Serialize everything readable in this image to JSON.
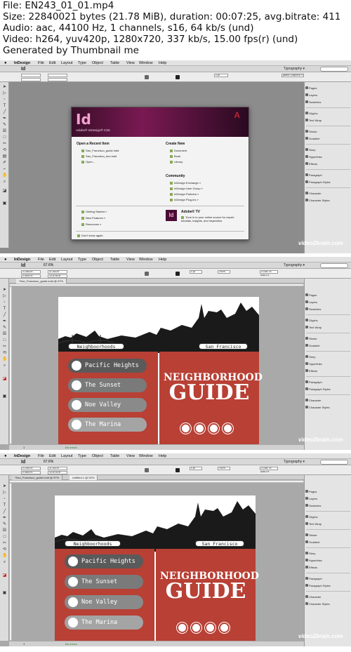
{
  "file_info": {
    "line1": "File: EN243_01_01.mp4",
    "line2": "Size: 22840021 bytes (21.78 MiB), duration: 00:07:25, avg.bitrate: 411",
    "line3": "Audio: aac, 44100 Hz, 1 channels, s16, 64 kb/s (und)",
    "line4": "Video: h264, yuv420p, 1280x720, 337 kb/s, 15.00 fps(r) (und)",
    "line5": "Generated by Thumbnail me"
  },
  "menubar": {
    "app": "InDesign",
    "items": [
      "File",
      "Edit",
      "Layout",
      "Type",
      "Object",
      "Table",
      "View",
      "Window",
      "Help"
    ]
  },
  "appbar": {
    "logo": "Id",
    "zoom": "67.6%",
    "workspace": "Typography ▾"
  },
  "control": {
    "x": "0.1563 in",
    "y": "0.0800 in",
    "w": "11.263 in",
    "h": "10.8750 in",
    "pt": "0 pt",
    "zoom": "100%",
    "stroke_w": "0.1667 in",
    "autofit": "Auto-Fit",
    "frame_style": "[Basic Graphics Frame]"
  },
  "panels": [
    "Pages",
    "Layers",
    "Swatches",
    "Glyphs",
    "Text Wrap",
    "Stroke",
    "Gradient",
    "Story",
    "Hyperlinks",
    "Effects",
    "Paragraph",
    "Paragraph Styles",
    "Character",
    "Character Styles"
  ],
  "welcome": {
    "logo": "Id",
    "product": "Adobe® InDesign® CS6",
    "adobe": "A",
    "open_heading": "Open a Recent Item",
    "recent": [
      "San_Francisco_guide.indd",
      "San_Francisco_tour.indd",
      "Open..."
    ],
    "create_heading": "Create New",
    "create": [
      "Document",
      "Book",
      "Library"
    ],
    "community_heading": "Community",
    "community": [
      "InDesign Exchange »",
      "InDesign User Group »",
      "InDesign Partners »",
      "InDesign Plug-ins »"
    ],
    "links": [
      "Getting Started »",
      "New Features »",
      "Resources »"
    ],
    "tv_title": "Adobe® TV",
    "tv_text": "Tune in to your online source for expert tutorials, insights, and inspiration.",
    "dont_show": "Don't show again"
  },
  "doc": {
    "tab1": "*San_Francisco_guide.indd @ 67%",
    "tab2": "Untitled-1 @ 52%",
    "label_left": "Neighboorhoods",
    "label_right": "San Francisco",
    "title1": "NEIGHBORHOOD",
    "title2": "GUIDE",
    "neighborhoods": [
      "Pacific Heights",
      "The Sunset",
      "Noe Valley",
      "The Marina"
    ],
    "status": "No errors",
    "page_num": "1"
  },
  "watermark": "video2brain.com",
  "colors": {
    "red": "#b84035",
    "pill_dark": "#555555",
    "pill_gray": "#888888"
  }
}
